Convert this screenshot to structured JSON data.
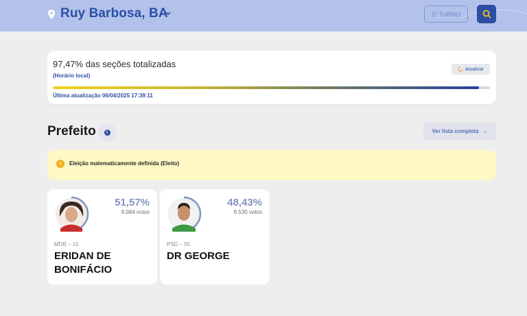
{
  "header": {
    "location": "Ruy Barbosa, BA",
    "round_label": "1º TURNO",
    "icons": {
      "location": "map-pin-icon",
      "dropdown": "chevron-down-icon",
      "search": "search-icon"
    }
  },
  "status": {
    "title": "97,47% das seções totalizadas",
    "subtitle": "(Horário local)",
    "refresh_label": "Atualizar",
    "progress_percent": 97.47,
    "last_update": "Última atualização 06/04/2025 17:39:11"
  },
  "section": {
    "title": "Prefeito",
    "list_button": "Ver lista completa",
    "list_arrow": "→"
  },
  "alert": {
    "icon": "!",
    "text": "Eleição matematicamente definida (Eleito)"
  },
  "candidates": [
    {
      "percent": "51,57%",
      "percent_value": 51.57,
      "votes": "9.084 votos",
      "party": "MDB – 15",
      "name": "ERIDAN DE BONIFÁCIO"
    },
    {
      "percent": "48,43%",
      "percent_value": 48.43,
      "votes": "8.530 votos",
      "party": "PSD – 55",
      "name": "DR GEORGE"
    }
  ],
  "colors": {
    "header_bg": "#b3c2ea",
    "brand_blue": "#2d4fa3",
    "alert_bg": "#fdf8c4",
    "ring": "#8393c1"
  }
}
